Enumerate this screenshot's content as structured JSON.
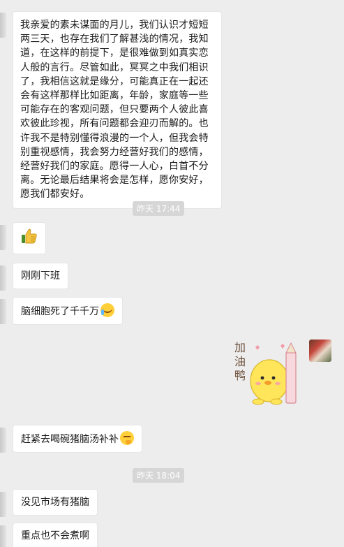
{
  "messages": [
    {
      "text": "我亲爱的素未谋面的月儿，我们认识才短短两三天，也存在我们了解甚浅的情况，我知道，在这样的前提下，是很难做到如真实恋人般的言行。尽管如此，冥冥之中我们相识了，我相信这就是缘分，可能真正在一起还会有这样那样比如距离，年龄，家庭等一些可能存在的客观问题，但只要两个人彼此喜欢彼此珍视，所有问题都会迎刃而解的。也许我不是特别懂得浪漫的一个人，但我会特别重视感情，我会努力经营好我们的感情，经营好我们的家庭。愿得一人心，白首不分离。无论最后结果将会是怎样，愿你安好，愿我们都安好。"
    },
    {
      "time": "昨天 17:44"
    },
    {
      "icon": "thumbs-up-icon"
    },
    {
      "text": "刚刚下班"
    },
    {
      "text": "脑细胞死了千千万",
      "icon": "crying-laughing-emoji-icon"
    },
    {
      "sticker_text": "加油鸭",
      "icon": "chick-pencil-sticker-icon"
    },
    {
      "text": "赶紧去喝碗猪脑汤补补",
      "icon": "thinking-face-emoji-icon"
    },
    {
      "time": "昨天 18:04"
    },
    {
      "text": "没见市场有猪脑"
    },
    {
      "text": "重点也不会煮啊"
    }
  ],
  "colors": {
    "background": "#ededed",
    "bubble": "#ffffff",
    "timestamp_bg": "#d6d6d6",
    "sticker_text": "#6b4f3a"
  }
}
